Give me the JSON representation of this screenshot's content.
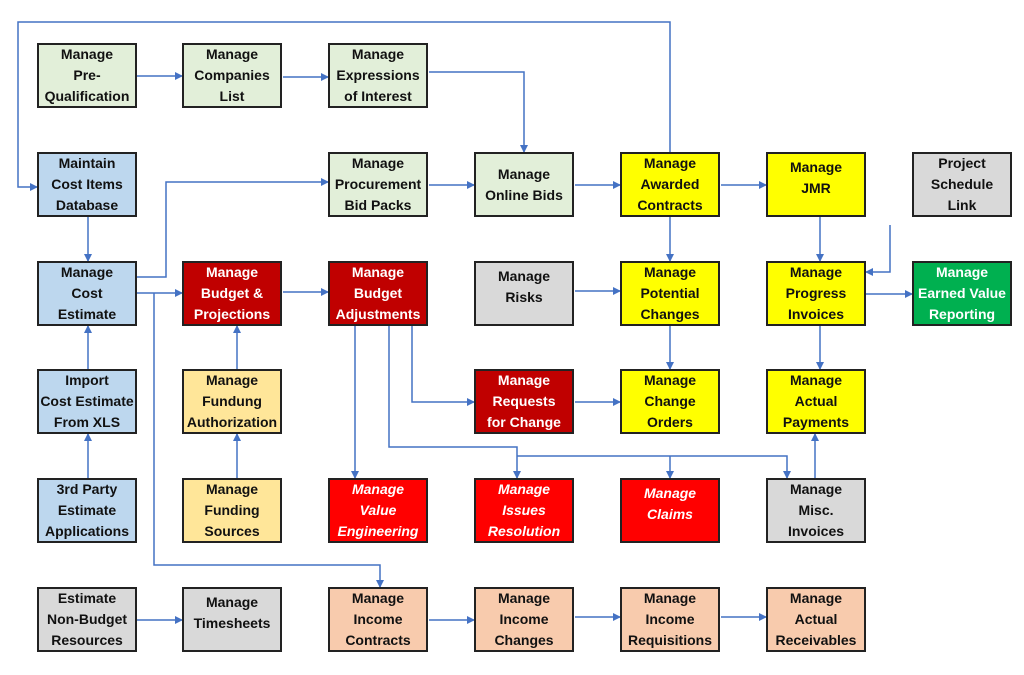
{
  "colors": {
    "arrow": "#4472c4",
    "green": "#e2efd9",
    "blue": "#bdd7ee",
    "darkred": "#c00000",
    "red": "#ff0000",
    "yellow": "#ffff00",
    "grey": "#d9d9d9",
    "lightyellow": "#ffe699",
    "peach": "#f8cbad",
    "brightgreen": "#00b050"
  },
  "boxes": [
    {
      "id": "prequal",
      "label": "Manage\nPre-\nQualification",
      "color": "green"
    },
    {
      "id": "companies",
      "label": "Manage\nCompanies\nList",
      "color": "green"
    },
    {
      "id": "expressions",
      "label": "Manage\nExpressions\nof Interest",
      "color": "green"
    },
    {
      "id": "costitems",
      "label": "Maintain\nCost Items\nDatabase",
      "color": "blue"
    },
    {
      "id": "procurement",
      "label": "Manage\nProcurement\nBid Packs",
      "color": "green"
    },
    {
      "id": "onlinebids",
      "label": "Manage\nOnline Bids",
      "color": "green"
    },
    {
      "id": "awarded",
      "label": "Manage\nAwarded\nContracts",
      "color": "yellow"
    },
    {
      "id": "jmr",
      "label": "Manage\nJMR",
      "color": "yellow",
      "valign": "top"
    },
    {
      "id": "schedule",
      "label": "Project\nSchedule\nLink",
      "color": "grey"
    },
    {
      "id": "costestimate",
      "label": "Manage\nCost\nEstimate",
      "color": "blue"
    },
    {
      "id": "budgetproj",
      "label": "Manage\nBudget &\nProjections",
      "color": "darkred",
      "text": "#fff"
    },
    {
      "id": "budgetadj",
      "label": "Manage\nBudget\nAdjustments",
      "color": "darkred",
      "text": "#fff"
    },
    {
      "id": "risks",
      "label": "Manage\nRisks",
      "color": "grey",
      "valign": "top"
    },
    {
      "id": "potential",
      "label": "Manage\nPotential\nChanges",
      "color": "yellow"
    },
    {
      "id": "progress",
      "label": "Manage\nProgress\nInvoices",
      "color": "yellow"
    },
    {
      "id": "earned",
      "label": "Manage\nEarned Value\nReporting",
      "color": "brightgreen",
      "text": "#fff"
    },
    {
      "id": "import",
      "label": "Import\nCost Estimate\nFrom XLS",
      "color": "blue"
    },
    {
      "id": "fundauth",
      "label": "Manage\nFundung\nAuthorization",
      "color": "lightyellow"
    },
    {
      "id": "rfc",
      "label": "Manage\nRequests\nfor Change",
      "color": "darkred",
      "text": "#fff"
    },
    {
      "id": "changeorders",
      "label": "Manage\nChange\nOrders",
      "color": "yellow"
    },
    {
      "id": "payments",
      "label": "Manage\nActual\nPayments",
      "color": "yellow"
    },
    {
      "id": "thirdparty",
      "label": "3rd Party\nEstimate\nApplications",
      "color": "blue"
    },
    {
      "id": "fundsources",
      "label": "Manage\nFunding\nSources",
      "color": "lightyellow"
    },
    {
      "id": "valueeng",
      "label": "Manage\nValue\nEngineering",
      "color": "red",
      "text": "#fff",
      "italic": true
    },
    {
      "id": "issues",
      "label": "Manage\nIssues\nResolution",
      "color": "red",
      "text": "#fff",
      "italic": true
    },
    {
      "id": "claims",
      "label": "Manage\nClaims",
      "color": "red",
      "text": "#fff",
      "italic": true,
      "valign": "top"
    },
    {
      "id": "misc",
      "label": "Manage\nMisc.\nInvoices",
      "color": "grey"
    },
    {
      "id": "nonbudget",
      "label": "Estimate\nNon-Budget\nResources",
      "color": "grey"
    },
    {
      "id": "timesheets",
      "label": "Manage\nTimesheets",
      "color": "grey",
      "valign": "top"
    },
    {
      "id": "incomecontracts",
      "label": "Manage\nIncome\nContracts",
      "color": "peach"
    },
    {
      "id": "incomechanges",
      "label": "Manage\nIncome\nChanges",
      "color": "peach"
    },
    {
      "id": "incomereq",
      "label": "Manage\nIncome\nRequisitions",
      "color": "peach"
    },
    {
      "id": "receivables",
      "label": "Manage\nActual\nReceivables",
      "color": "peach"
    }
  ]
}
